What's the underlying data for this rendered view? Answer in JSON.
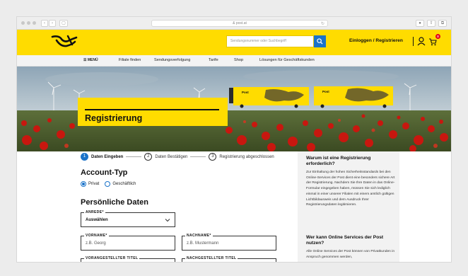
{
  "browser": {
    "url": "& post.at"
  },
  "header": {
    "search_placeholder": "Sendungsnummer oder Suchbegriff",
    "login": "Einloggen / Registrieren",
    "cart_count": "0"
  },
  "nav": {
    "items": [
      "MENÜ",
      "Filiale finden",
      "Sendungsverfolgung",
      "Tarife",
      "Shop",
      "Lösungen für Geschäftskunden"
    ]
  },
  "hero": {
    "title": "Registrierung",
    "truck_label_1": "Post",
    "truck_label_2": "Post"
  },
  "steps": [
    {
      "num": "1",
      "label": "Daten Eingeben",
      "active": true
    },
    {
      "num": "2",
      "label": "Daten Bestätigen",
      "active": false
    },
    {
      "num": "3",
      "label": "Registrierung abgeschlossen",
      "active": false
    }
  ],
  "account": {
    "heading": "Account-Typ",
    "option_private": "Privat",
    "option_business": "Geschäftlich",
    "selected": "Privat"
  },
  "personal": {
    "heading": "Persönliche Daten",
    "anrede_label": "ANREDE*",
    "anrede_value": "Auswählen",
    "vorname_label": "VORNAME*",
    "vorname_placeholder": "z.B. Georg",
    "nachname_label": "NACHNAME*",
    "nachname_placeholder": "z.B. Mustermann",
    "vortitel_label": "VORANGESTELLTER TITEL",
    "nachtitel_label": "NACHGESTELLTER TITEL"
  },
  "sidebar": {
    "heading1": "Warum ist eine Registrierung erforderlich?",
    "text1": "Zur Einhaltung der hohen Sicherheitsstandards bei den Online-Services der Post dient eine besonders sichere Art der Registrierung. Nachdem Sie Ihre Daten in das Online-Formular eingegeben haben, müssen Sie sich lediglich einmal in einer unserer Filialen mit einem amtlich gültigen Lichtbildausweis und dem Ausdruck Ihrer Registrierungsdaten legitimieren.",
    "heading2": "Wer kann Online Services der Post nutzen?",
    "text2": "Alle Online Services der Post können von Privatkunden in Anspruch genommen werden,"
  },
  "colors": {
    "brand_yellow": "#ffdc00",
    "accent_blue": "#1a73c9",
    "badge_red": "#e2001a"
  }
}
